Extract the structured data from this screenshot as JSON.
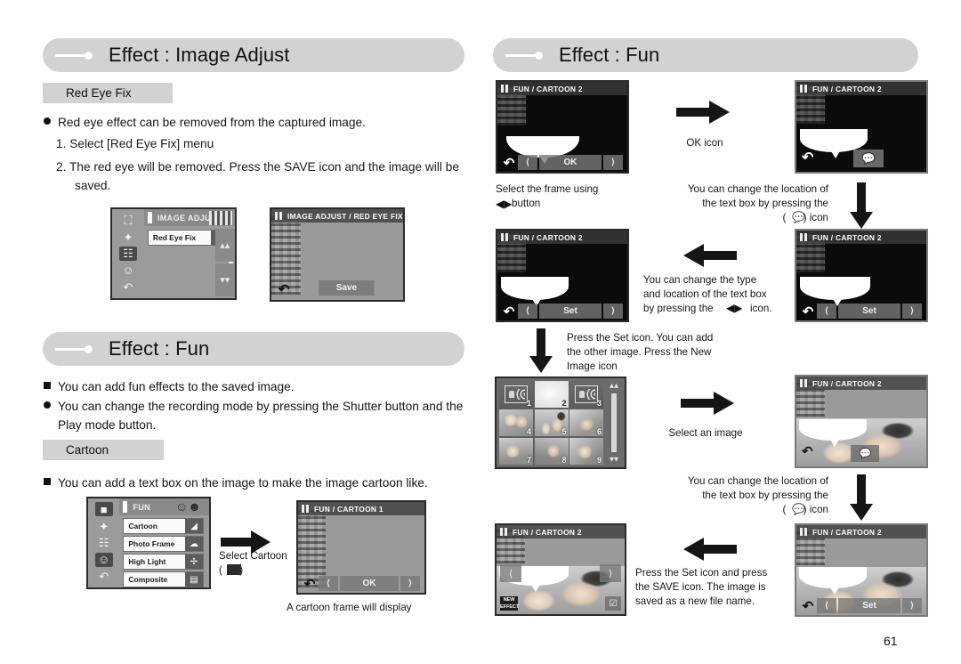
{
  "page": {
    "number": "61"
  },
  "left": {
    "section1": {
      "title": "Effect : Image Adjust",
      "sublabel": "Red Eye Fix",
      "bullet": "Red eye effect can be removed from the captured image.",
      "step1": "1.  Select [Red Eye Fix] menu",
      "step2": "2.  The red eye will be removed. Press the SAVE icon and the image will be",
      "step2b": "saved.",
      "menu_screen": {
        "title": "IMAGE ADJUST",
        "rows": [
          {
            "label": "Red Eye Fix",
            "icon": "red-eye-fix-icon"
          }
        ],
        "up_icon": "scroll-up-icon",
        "down_icon": "scroll-down-icon"
      },
      "result_screen": {
        "title": "IMAGE ADJUST / RED EYE FIX",
        "save_label": "Save",
        "back_icon": "back-icon"
      }
    },
    "section2": {
      "title": "Effect : Fun",
      "bullet_square": "You can add fun effects to the saved image.",
      "bullet_round_1": "You can change the recording mode by pressing the Shutter button and the",
      "bullet_round_2": "Play mode button.",
      "sublabel": "Cartoon",
      "bullet_square_2": "You can add a text box on the image to make the image cartoon like.",
      "fun_menu": {
        "title": "FUN",
        "rows": [
          {
            "label": "Cartoon",
            "icon": "cartoon-icon"
          },
          {
            "label": "Photo Frame",
            "icon": "photo-frame-icon"
          },
          {
            "label": "High Light",
            "icon": "high-light-icon"
          },
          {
            "label": "Composite",
            "icon": "composite-icon"
          }
        ]
      },
      "arrow_caption_1": "Select Cartoon",
      "arrow_caption_2": "(       )",
      "cartoon_screen": {
        "title": "FUN / CARTOON 1",
        "ok_label": "OK",
        "back_icon": "back-icon"
      },
      "cartoon_caption": "A cartoon frame will display"
    }
  },
  "right": {
    "title": "Effect : Fun",
    "screens": {
      "s1": {
        "title": "FUN / CARTOON 2",
        "ok_label": "OK",
        "back_icon": "back-icon"
      },
      "s2": {
        "title": "FUN / CARTOON 2",
        "bubble_icon": "speech-bubble-icon",
        "back_icon": "back-icon"
      },
      "s3": {
        "title": "FUN / CARTOON 2",
        "set_label": "Set",
        "back_icon": "back-icon"
      },
      "s4": {
        "title": "FUN / CARTOON 2",
        "set_label": "Set",
        "back_icon": "back-icon"
      },
      "s5": {
        "title": "FUN / CARTOON 2",
        "bubble_icon": "speech-bubble-icon",
        "back_icon": "back-icon"
      },
      "s6": {
        "title": "FUN / CARTOON 2",
        "set_label": "Set",
        "back_icon": "back-icon"
      },
      "thumbnails": {
        "numbers": [
          "1",
          "2",
          "3",
          "4",
          "5",
          "6",
          "7",
          "8",
          "9"
        ],
        "up_icon": "scroll-up-icon",
        "down_icon": "scroll-down-icon"
      }
    },
    "captions": {
      "c1_l1": "Select the frame using",
      "c1_l2": "button",
      "c2": "OK icon",
      "c3_l1": "You can change the location of",
      "c3_l2": "the text box by pressing the",
      "c3_l3": ") icon",
      "c4_l1": "You can change the type",
      "c4_l2": "and location of the text box",
      "c4_l3": "by pressing the",
      "c4_l4": "icon.",
      "c5_l1": "Press the Set icon. You can add",
      "c5_l2": "the other image. Press the New",
      "c5_l3": "Image icon",
      "c6": "Select an image",
      "c7_l1": "You can change the location of",
      "c7_l2": "the text box by pressing the",
      "c7_l3": ") icon",
      "c8_l1": "Press the Set icon and press",
      "c8_l2": "the SAVE icon. The image is",
      "c8_l3": "saved as a new file name."
    }
  }
}
